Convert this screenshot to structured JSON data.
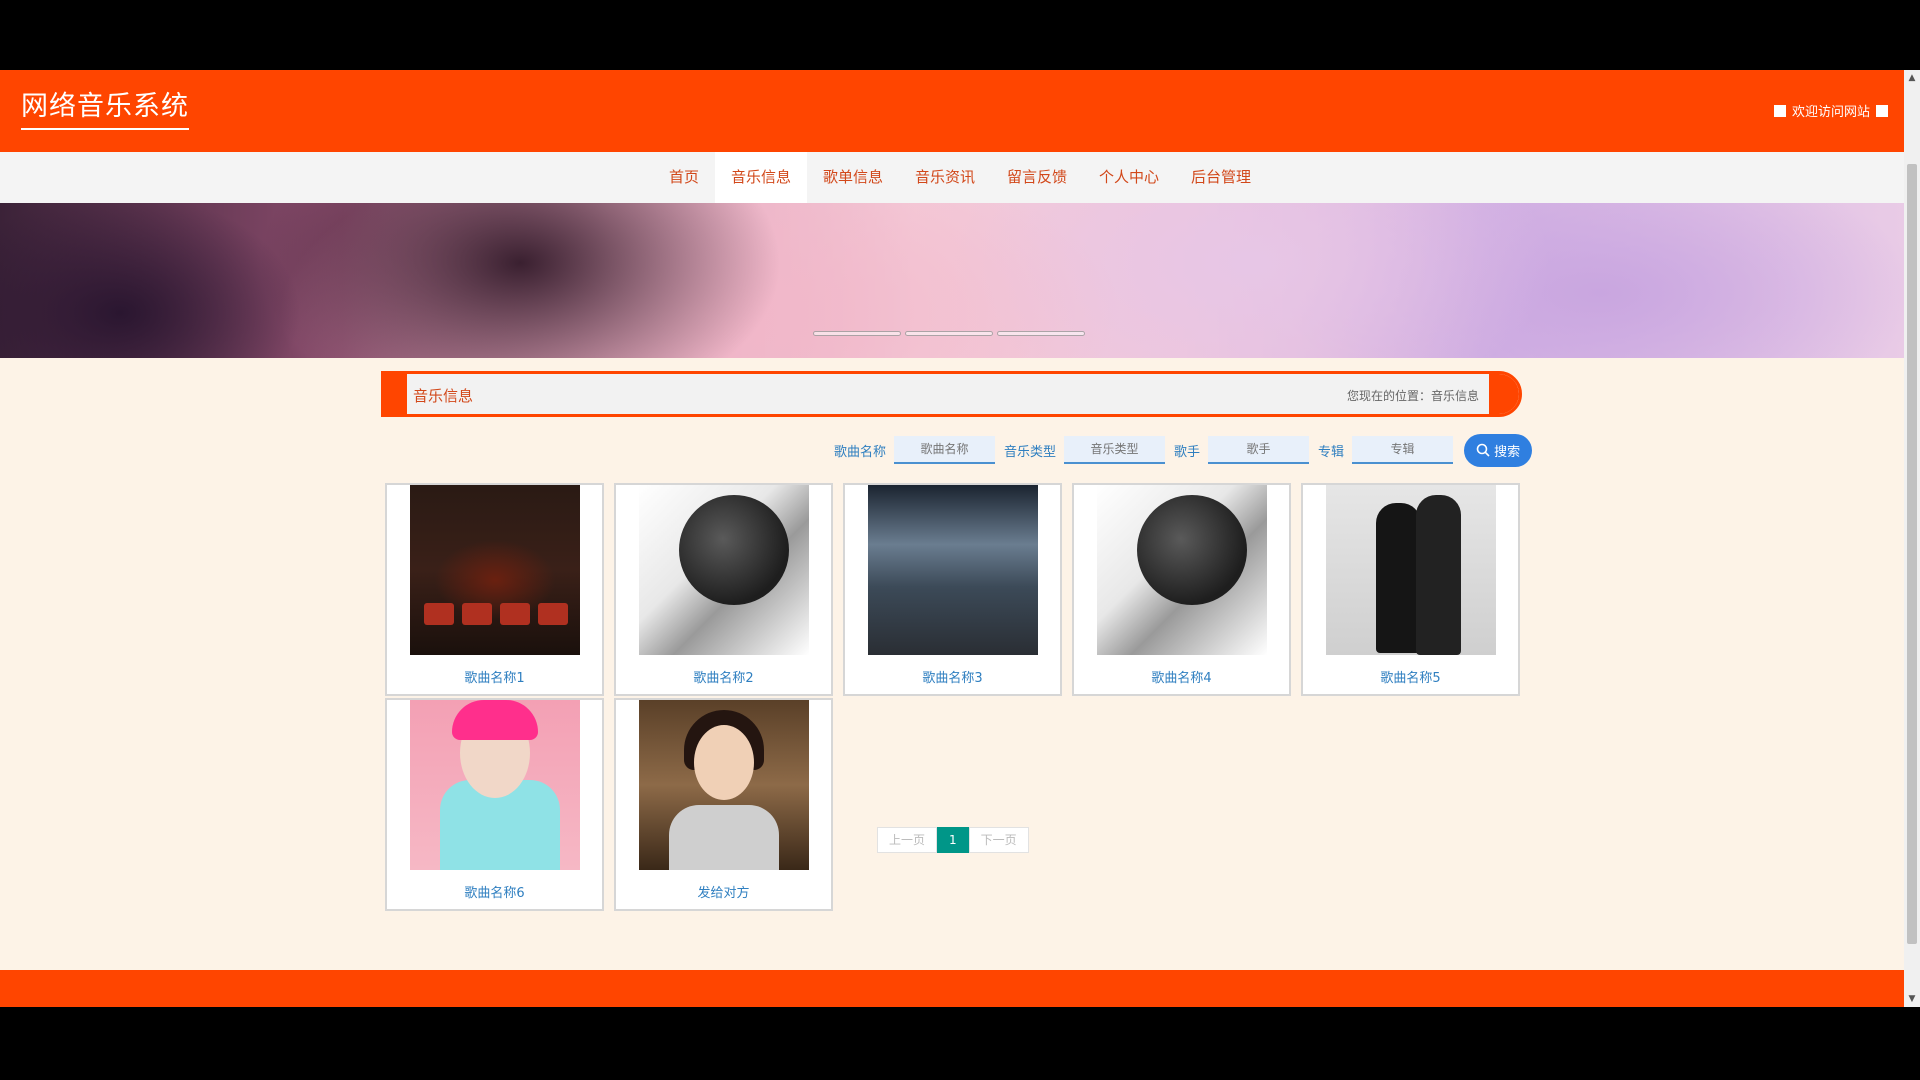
{
  "header": {
    "title": "网络音乐系统",
    "welcome": "欢迎访问网站"
  },
  "nav": {
    "items": [
      {
        "label": "首页"
      },
      {
        "label": "音乐信息"
      },
      {
        "label": "歌单信息"
      },
      {
        "label": "音乐资讯"
      },
      {
        "label": "留言反馈"
      },
      {
        "label": "个人中心"
      },
      {
        "label": "后台管理"
      }
    ],
    "active_index": 1
  },
  "breadcrumb": {
    "title": "音乐信息",
    "location": "您现在的位置：音乐信息"
  },
  "search": {
    "fields": [
      {
        "label": "歌曲名称",
        "placeholder": "歌曲名称"
      },
      {
        "label": "音乐类型",
        "placeholder": "音乐类型"
      },
      {
        "label": "歌手",
        "placeholder": "歌手"
      },
      {
        "label": "专辑",
        "placeholder": "专辑"
      }
    ],
    "button_label": "搜索"
  },
  "songs": [
    {
      "title": "歌曲名称1"
    },
    {
      "title": "歌曲名称2"
    },
    {
      "title": "歌曲名称3"
    },
    {
      "title": "歌曲名称4"
    },
    {
      "title": "歌曲名称5"
    },
    {
      "title": "歌曲名称6"
    },
    {
      "title": "发给对方"
    }
  ],
  "pagination": {
    "prev": "上一页",
    "current": "1",
    "next": "下一页"
  },
  "colors": {
    "primary": "#ff4500",
    "link": "#2f7fc0",
    "page_active": "#009688",
    "background": "#fdf3e7"
  }
}
